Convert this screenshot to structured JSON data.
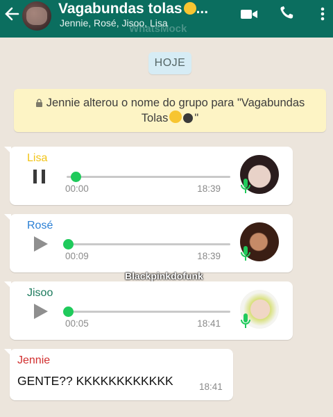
{
  "header": {
    "title": "Vagabundas tolas",
    "title_suffix": "...",
    "members": "Jennie, Rosé, Jisoo, Lisa",
    "watermark": "WhatsMock"
  },
  "date_divider": "HOJE",
  "system_message": {
    "line1": "Jennie alterou o nome do grupo para \"Vagabundas",
    "line2": "Tolas",
    "line2_end": "\""
  },
  "voice_messages": [
    {
      "sender": "Lisa",
      "sender_color": "#f2c417",
      "duration": "00:00",
      "time": "18:39",
      "state": "playing"
    },
    {
      "sender": "Rosé",
      "sender_color": "#2a7fd4",
      "duration": "00:09",
      "time": "18:39",
      "state": "paused"
    },
    {
      "sender": "Jisoo",
      "sender_color": "#1b7a5c",
      "duration": "00:05",
      "time": "18:41",
      "state": "paused"
    }
  ],
  "text_message": {
    "sender": "Jennie",
    "sender_color": "#d12e2e",
    "text": "GENTE?? KKKKKKKKKKKK",
    "time": "18:41"
  },
  "overlay_watermark": "Blackpinkdofunk",
  "colors": {
    "header": "#0b6e5f",
    "accent_green": "#1fca5b",
    "chat_bg": "#ece5dc"
  }
}
